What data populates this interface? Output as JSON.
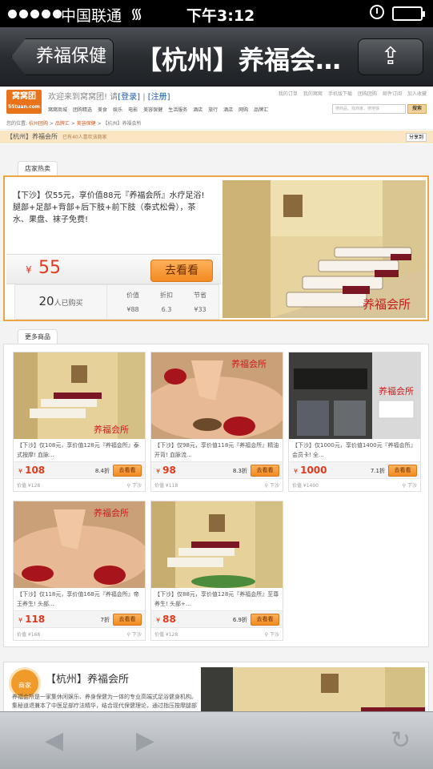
{
  "status": {
    "carrier": "中国联通",
    "time": "下午3:12"
  },
  "nav": {
    "back": "养福保健",
    "title": "【杭州】养福会…"
  },
  "site": {
    "logo_text": "窝窝团",
    "logo_sub": "55tuan.com",
    "welcome": "欢迎来到窝窝团! 请",
    "login": "[登录]",
    "sep": "|",
    "register": "[注册]",
    "top_links": [
      "我的订单",
      "我的窝窝",
      "手机版下载",
      "团购团购",
      "邮件订阅",
      "加入收藏"
    ],
    "main_nav": [
      "窝窝商城",
      "团购精选",
      "美食",
      "娱乐",
      "电影",
      "美容保健",
      "生活服务",
      "酒店",
      "旅行",
      "酒店",
      "网购",
      "品牌汇"
    ],
    "search_placeholder": "搜商品、找商家、搜地铁",
    "search_btn": "搜索",
    "breadcrumb_prefix": "您的位置:",
    "breadcrumb": [
      "杭州团购",
      "品牌汇",
      "美容保健",
      "【杭州】养福会所"
    ],
    "category": "【杭州】养福会所",
    "category_sub": "已有40人喜欢该商家",
    "share_select": "分享到"
  },
  "hot": {
    "tab": "店家热卖",
    "desc": "【下沙】仅55元，享价值88元『养福会所』水疗足浴! 腿部+足部+背部+后下肢+前下肢（泰式松骨），茶水、果盘、袜子免费!",
    "currency": "¥",
    "price": "55",
    "btn": "去看看",
    "bought_count": "20",
    "bought_label": "人已购买",
    "cols": [
      {
        "h": "价值",
        "v": "¥88"
      },
      {
        "h": "折扣",
        "v": "6.3"
      },
      {
        "h": "节省",
        "v": "¥33"
      }
    ],
    "img_caption": "养福会所"
  },
  "more": {
    "tab": "更多商品",
    "items": [
      {
        "desc": "【下沙】仅108元，享价值128元『养福会所』泰式按摩! 血脉...",
        "price": "108",
        "disc": "8.4折",
        "btn": "去看看",
        "value": "价值 ¥128",
        "loc": "下沙",
        "caption": "养福会所"
      },
      {
        "desc": "【下沙】仅98元，享价值118元『养福会所』精油开背! 血脉流...",
        "price": "98",
        "disc": "8.3折",
        "btn": "去看看",
        "value": "价值 ¥118",
        "loc": "下沙",
        "caption": "养福会所"
      },
      {
        "desc": "【下沙】仅1000元，享价值1400元『养福会所』会员卡! 全...",
        "price": "1000",
        "disc": "7.1折",
        "btn": "去看看",
        "value": "价值 ¥1400",
        "loc": "下沙",
        "caption": "养福会所"
      },
      {
        "desc": "【下沙】仅118元，享价值168元『养福会所』帝王养生! 头部...",
        "price": "118",
        "disc": "7折",
        "btn": "去看看",
        "value": "价值 ¥168",
        "loc": "下沙",
        "caption": "养福会所"
      },
      {
        "desc": "【下沙】仅88元，享价值128元『养福会所』至尊养生! 头部+...",
        "price": "88",
        "disc": "6.9折",
        "btn": "去看看",
        "value": "价值 ¥128",
        "loc": "下沙",
        "caption": "养福会所"
      }
    ]
  },
  "shop": {
    "badge": "商家",
    "name": "【杭州】养福会所",
    "desc": "养福会所是一家集休闲娱乐、养身保健为一体的专业高端式足浴健身机构。集秘道退兼本了中医足部疗法精华，结合现代保健理论，通过指压按摩腿部刺激..."
  },
  "colors": {
    "accent": "#f38a21",
    "price": "#e3391d"
  }
}
